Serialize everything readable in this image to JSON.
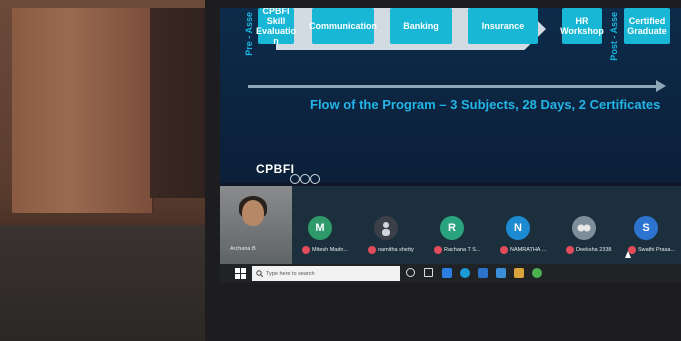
{
  "slide": {
    "left_label": "Pre - Asse",
    "right_label": "Post - Asse",
    "boxes": [
      "CPBFI Skill Evaluatio n",
      "Communication",
      "Banking",
      "Insurance",
      "HR Workshop",
      "Certified Graduate"
    ],
    "caption": "Flow of the Program – 3 Subjects, 28 Days, 2 Certificates",
    "logo": "CPBFI"
  },
  "participants": [
    {
      "name": "Archana B",
      "initial": "",
      "color": "#6b6f72"
    },
    {
      "name": "Mitesh Madn...",
      "initial": "M",
      "color": "#2e9a6a"
    },
    {
      "name": "namitha shetty",
      "initial": "",
      "color": "#3a3f49"
    },
    {
      "name": "Rachana T S...",
      "initial": "R",
      "color": "#2aa37f"
    },
    {
      "name": "NAMRATHA ...",
      "initial": "N",
      "color": "#1d8bd1"
    },
    {
      "name": "Deeksha 2338",
      "initial": "",
      "color": "#7f8f9a"
    },
    {
      "name": "Swathi Prasa...",
      "initial": "S",
      "color": "#2d74d1"
    }
  ],
  "taskbar": {
    "search_placeholder": "Type here to search",
    "icons": [
      "cortana-icon",
      "task-view-icon",
      "dropbox-icon",
      "edge-icon",
      "mail-icon",
      "store-icon",
      "bag-icon",
      "chrome-icon"
    ]
  },
  "device": {
    "brand": "hp"
  },
  "colors": {
    "accent": "#19b7d6",
    "caption": "#22b5e6",
    "mic_off": "#e24b59"
  }
}
